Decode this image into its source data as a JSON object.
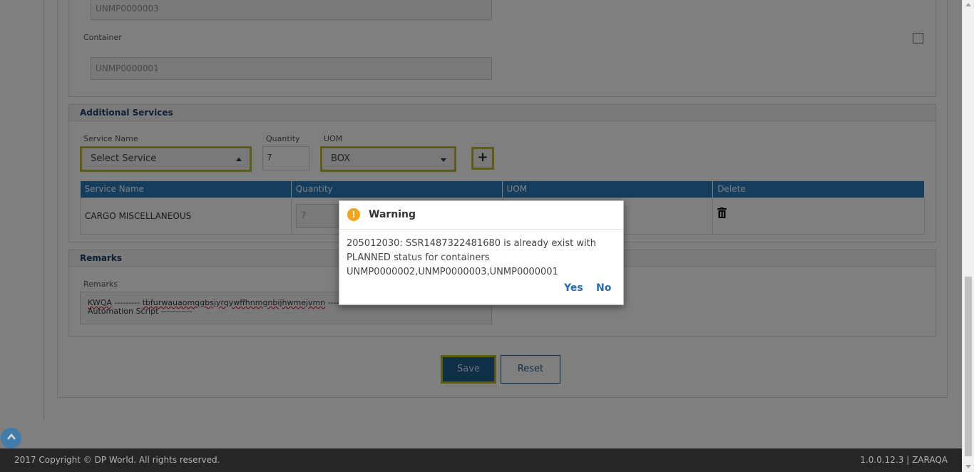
{
  "containers": {
    "prev_value": "UNMP0000003",
    "label": "Container",
    "value": "UNMP0000001"
  },
  "additional_services": {
    "title": "Additional Services",
    "service_name_label": "Service Name",
    "service_select_value": "Select Service",
    "quantity_label": "Quantity",
    "quantity_value": "7",
    "uom_label": "UOM",
    "uom_value": "BOX",
    "add_icon": "plus-icon",
    "table": {
      "headers": [
        "Service Name",
        "Quantity",
        "UOM",
        "Delete"
      ],
      "rows": [
        {
          "service_name": "CARGO MISCELLANEOUS",
          "quantity": "7",
          "uom": "",
          "delete_icon": "trash-icon"
        }
      ]
    }
  },
  "remarks": {
    "title": "Remarks",
    "label": "Remarks",
    "text_part1": "KWQA",
    "text_part2": " --------- ",
    "text_part3": "tbfurwauaomqgbsjyrqywffhnmgnbijhwmejvmn",
    "text_part4": " ------",
    "text_part5": "Automation Script -----------"
  },
  "actions": {
    "save_label": "Save",
    "reset_label": "Reset"
  },
  "dialog": {
    "title": "Warning",
    "icon": "exclamation-icon",
    "line1": "205012030: SSR1487322481680 is already exist with",
    "line2": "PLANNED status for containers",
    "line3": "UNMP0000002,UNMP0000003,UNMP0000001",
    "yes_label": "Yes",
    "no_label": "No"
  },
  "footer": {
    "copyright": "2017 Copyright © DP World. All rights reserved.",
    "version": "1.0.0.12.3 | ZARAQA"
  },
  "colors": {
    "accent": "#2a7bbd",
    "highlight_border": "#bdb729",
    "save_button": "#1e5f8f",
    "warning": "#f4a31b",
    "footer_bg": "#262626"
  }
}
